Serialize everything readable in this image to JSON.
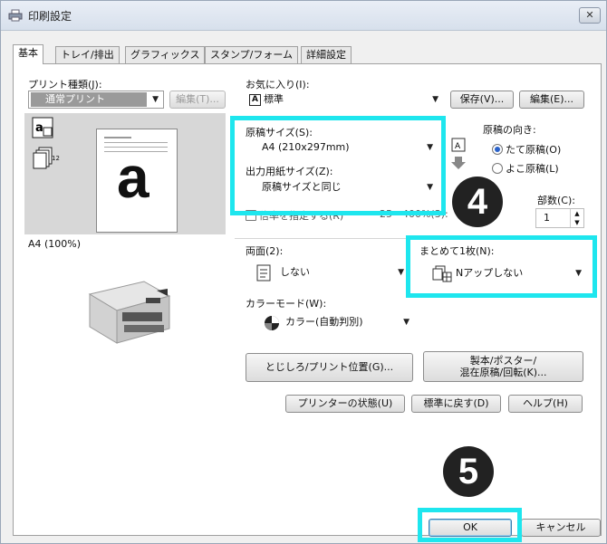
{
  "window": {
    "title": "印刷設定",
    "close_label": "✕"
  },
  "tabs": [
    {
      "label": "基本",
      "active": true
    },
    {
      "label": "トレイ/排出"
    },
    {
      "label": "グラフィックス"
    },
    {
      "label": "スタンプ/フォーム"
    },
    {
      "label": "詳細設定"
    }
  ],
  "print_type": {
    "label": "プリント種類(J):",
    "value": "通常プリント",
    "edit_label": "編集(T)..."
  },
  "favorites": {
    "label": "お気に入り(I):",
    "value": "標準",
    "save_label": "保存(V)...",
    "edit_label": "編集(E)..."
  },
  "original_size": {
    "label": "原稿サイズ(S):",
    "value": "A4 (210x297mm)"
  },
  "output_size": {
    "label": "出力用紙サイズ(Z):",
    "value": "原稿サイズと同じ"
  },
  "scale": {
    "label": "倍率を指定する(R)",
    "range": "25 - 400%(3):",
    "checked": false
  },
  "orientation": {
    "label": "原稿の向き:",
    "portrait": "たて原稿(O)",
    "landscape": "よこ原稿(L)",
    "selected": "portrait"
  },
  "copies": {
    "label": "部数(C):",
    "value": "1"
  },
  "preview": {
    "caption": "A4 (100%)",
    "page_letter": "a",
    "sheet_count": "12"
  },
  "duplex": {
    "label": "両面(2):",
    "value": "しない"
  },
  "nup": {
    "label": "まとめて1枚(N):",
    "value": "Nアップしない"
  },
  "color_mode": {
    "label": "カラーモード(W):",
    "value": "カラー(自動判別)"
  },
  "buttons": {
    "binding": "とじしろ/プリント位置(G)...",
    "booklet_line1": "製本/ポスター/",
    "booklet_line2": "混在原稿/回転(K)...",
    "printer_status": "プリンターの状態(U)",
    "restore_default": "標準に戻す(D)",
    "help": "ヘルプ(H)",
    "ok": "OK",
    "cancel": "キャンセル"
  },
  "steps": {
    "step4": "4",
    "step5": "5"
  },
  "highlight_color": "#1ee6ee"
}
